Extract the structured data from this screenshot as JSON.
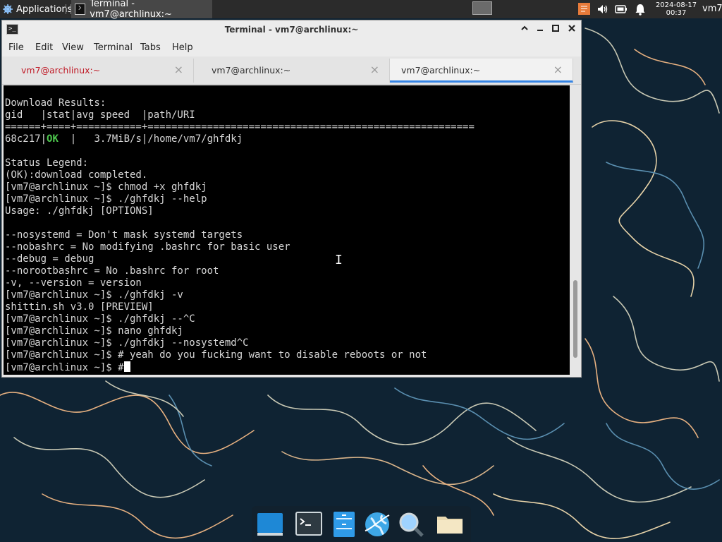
{
  "top_panel": {
    "applications_label": "Applications",
    "task_button_label": "Terminal - vm7@archlinux:~",
    "clock_date": "2024-08-17",
    "clock_time": "00:37",
    "user": "vm7",
    "tray_icons": [
      "notes-icon",
      "volume-icon",
      "battery-icon",
      "bell-icon"
    ]
  },
  "window": {
    "title": "Terminal - vm7@archlinux:~",
    "menu": [
      "File",
      "Edit",
      "View",
      "Terminal",
      "Tabs",
      "Help"
    ],
    "tabs": [
      {
        "label": "vm7@archlinux:~",
        "state": "alert"
      },
      {
        "label": "vm7@archlinux:~",
        "state": "normal"
      },
      {
        "label": "vm7@archlinux:~",
        "state": "active"
      }
    ],
    "scroll_position": 0.92
  },
  "terminal": {
    "lines": [
      "Download Results:",
      "gid   |stat|avg speed  |path/URI",
      "======+====+===========+=======================================================",
      "68c217|OK  |   3.7MiB/s|/home/vm7/ghfdkj",
      "",
      "Status Legend:",
      "(OK):download completed.",
      "[vm7@archlinux ~]$ chmod +x ghfdkj",
      "[vm7@archlinux ~]$ ./ghfdkj --help",
      "Usage: ./ghfdkj [OPTIONS]",
      "",
      "--nosystemd = Don't mask systemd targets",
      "--nobashrc = No modifying .bashrc for basic user",
      "--debug = debug",
      "--norootbashrc = No .bashrc for root",
      "-v, --version = version",
      "[vm7@archlinux ~]$ ./ghfdkj -v",
      "shittin.sh v3.0 [PREVIEW]",
      "[vm7@archlinux ~]$ ./ghfdkj --^C",
      "[vm7@archlinux ~]$ nano ghfdkj",
      "[vm7@archlinux ~]$ ./ghfdkj --nosystemd^C",
      "[vm7@archlinux ~]$ # yeah do you fucking want to disable reboots or not",
      "[vm7@archlinux ~]$ #"
    ]
  },
  "dock": {
    "items": [
      "show-desktop-icon",
      "terminal-icon",
      "file-manager-icon",
      "web-browser-icon",
      "app-finder-icon",
      "folder-icon"
    ]
  },
  "colors": {
    "ok": "#4ec94e",
    "tab_alert": "#c01c28",
    "tab_active_underline": "#3584e4",
    "panel": "#2b2b2b",
    "wallpaper_bg": "#0f2333"
  }
}
